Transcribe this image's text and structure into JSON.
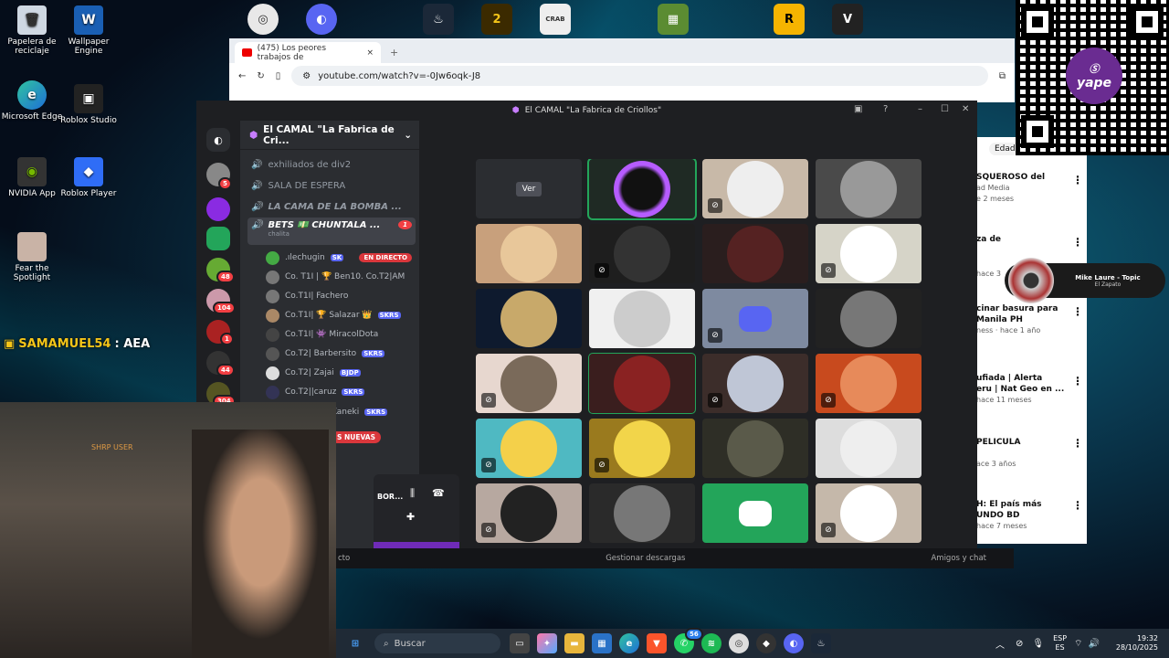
{
  "desktop": {
    "icons": [
      {
        "label": "Papelera de reciclaje"
      },
      {
        "label": "Wallpaper Engine"
      },
      {
        "label": "Microsoft Edge"
      },
      {
        "label": "Roblox Studio"
      },
      {
        "label": "NVIDIA App"
      },
      {
        "label": "Roblox Player"
      },
      {
        "label": "Fear the Spotlight"
      }
    ]
  },
  "browser": {
    "tab_title": "(475) Los peores trabajos de",
    "url": "youtube.com/watch?v=-0Jw6oqk-J8",
    "tab_close": "×",
    "new_tab": "+"
  },
  "youtube_side": {
    "header_btn": "Edad",
    "items": [
      {
        "title": "SQUEROSO del",
        "meta1": "ad Media",
        "meta2": "e 2 meses"
      },
      {
        "title": "za de",
        "meta1": "hace 3",
        "meta2": ""
      },
      {
        "title": "cinar basura para",
        "meta1": "Manila PH",
        "meta2": "ness · hace 1 año"
      },
      {
        "title": "ufiada | Alerta",
        "meta1": "eru | Nat Geo en ...",
        "meta2": "hace 11 meses"
      },
      {
        "title": "PELICULA",
        "meta1": "ace 3 años",
        "meta2": ""
      },
      {
        "title": "H: El país más",
        "meta1": "UNDO BD",
        "meta2": "hace 7 meses"
      }
    ]
  },
  "music_widget": {
    "artist": "Mike Laure - Topic",
    "song": "El Zapato"
  },
  "qr": {
    "brand": "yape"
  },
  "discord": {
    "window_title": "El CAMAL \"La Fabrica de Criollos\"",
    "server_name": "El CAMAL \"La Fabrica de Cri...",
    "server_badges": [
      "5",
      "",
      "",
      "48",
      "104",
      "1",
      "44",
      "304"
    ],
    "channels": [
      {
        "name": "exhiliados de div2"
      },
      {
        "name": "SALA DE ESPERA"
      },
      {
        "name": "LA CAMA DE LA BOMBA ..."
      },
      {
        "name": "BETS 💵 CHUNTALA ...",
        "sub": "chalita",
        "badge": "1"
      }
    ],
    "voice_users": [
      {
        "name": ".ılechugin",
        "tag": "SK",
        "live": "EN DIRECTO"
      },
      {
        "name": "Co. T1I | 🏆 Ben10. Co.T2|AM",
        "tag": ""
      },
      {
        "name": "Co.T1I| Fachero",
        "tag": ""
      },
      {
        "name": "Co.T1I| 🏆 Salazar 👑",
        "tag": "SKRS"
      },
      {
        "name": "Co.T1I| 👾 MiracolDota",
        "tag": ""
      },
      {
        "name": "Co.T2| Barbersito",
        "tag": "SKRS"
      },
      {
        "name": "Co.T2| Zajai",
        "tag": "BJDP"
      },
      {
        "name": "Co.T2||caruz",
        "tag": "SKRS"
      },
      {
        "name": "Kaneki",
        "tag": "SKRS"
      }
    ],
    "news_label": "S NUEVAS",
    "voice_status": "BOR...",
    "watch_label": "Ver",
    "bottom": {
      "left": "cto",
      "downloads": "Gestionar descargas",
      "friends": "Amigos y chat"
    }
  },
  "stream": {
    "chat_user": "SAMAMUEL54",
    "chat_msg": ": AEA",
    "cam_label": "SHRP USER"
  },
  "taskbar": {
    "search": "Buscar",
    "lang1": "ESP",
    "lang2": "ES",
    "time": "19:32",
    "date": "28/10/2025",
    "edge_badge": "56"
  }
}
